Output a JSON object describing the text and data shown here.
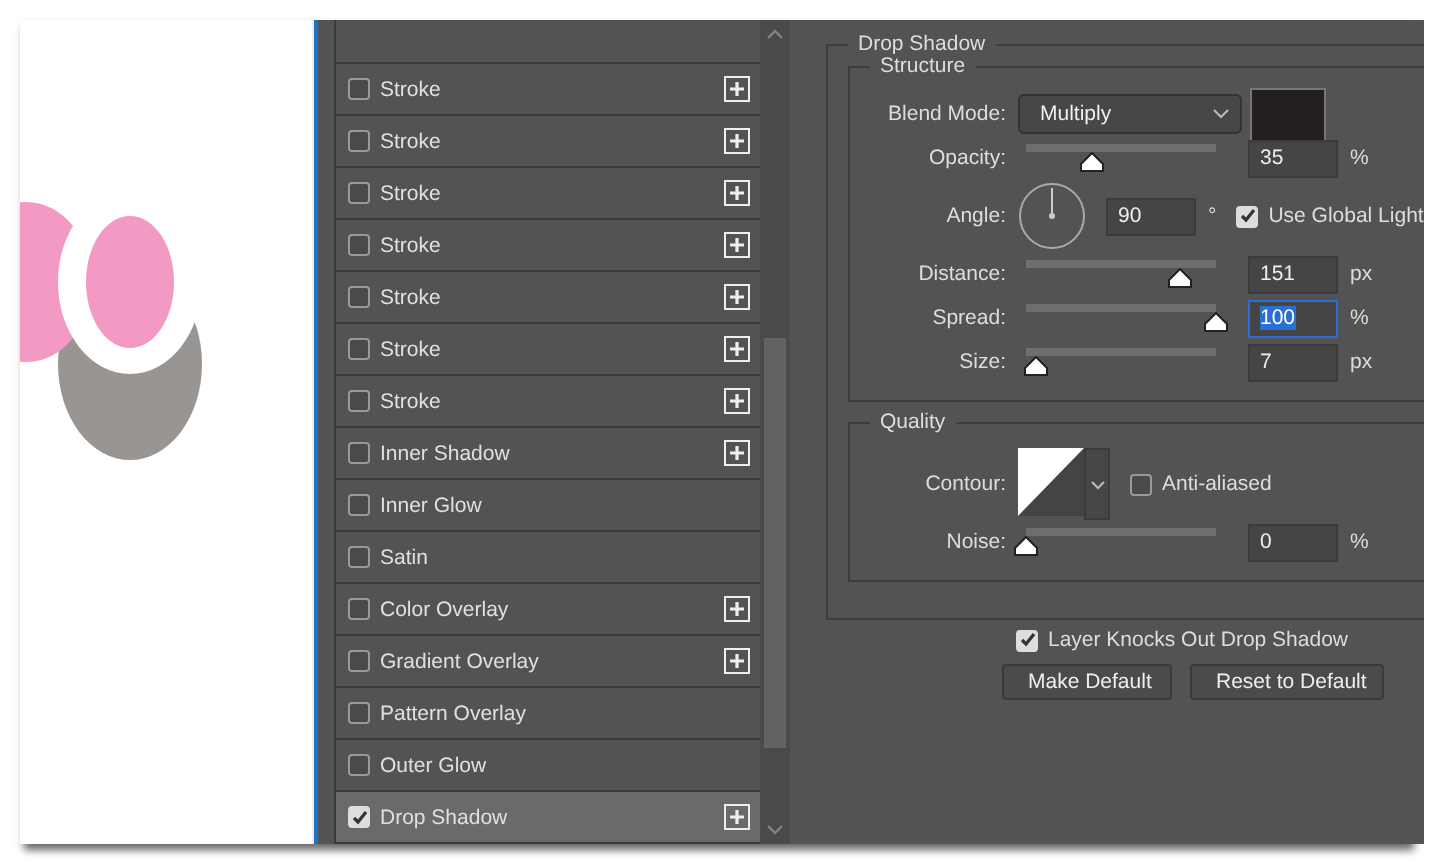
{
  "styles_list": [
    {
      "label": "Stroke",
      "checked": false,
      "addable": true,
      "selected": false
    },
    {
      "label": "Stroke",
      "checked": false,
      "addable": true,
      "selected": false
    },
    {
      "label": "Stroke",
      "checked": false,
      "addable": true,
      "selected": false
    },
    {
      "label": "Stroke",
      "checked": false,
      "addable": true,
      "selected": false
    },
    {
      "label": "Stroke",
      "checked": false,
      "addable": true,
      "selected": false
    },
    {
      "label": "Stroke",
      "checked": false,
      "addable": true,
      "selected": false
    },
    {
      "label": "Stroke",
      "checked": false,
      "addable": true,
      "selected": false
    },
    {
      "label": "Inner Shadow",
      "checked": false,
      "addable": true,
      "selected": false
    },
    {
      "label": "Inner Glow",
      "checked": false,
      "addable": false,
      "selected": false
    },
    {
      "label": "Satin",
      "checked": false,
      "addable": false,
      "selected": false
    },
    {
      "label": "Color Overlay",
      "checked": false,
      "addable": true,
      "selected": false
    },
    {
      "label": "Gradient Overlay",
      "checked": false,
      "addable": true,
      "selected": false
    },
    {
      "label": "Pattern Overlay",
      "checked": false,
      "addable": false,
      "selected": false
    },
    {
      "label": "Outer Glow",
      "checked": false,
      "addable": false,
      "selected": false
    },
    {
      "label": "Drop Shadow",
      "checked": true,
      "addable": true,
      "selected": true
    }
  ],
  "drop_shadow": {
    "title": "Drop Shadow",
    "structure": {
      "title": "Structure",
      "blend_mode": {
        "label": "Blend Mode:",
        "value": "Multiply"
      },
      "rows": [
        {
          "kind": "slider",
          "label": "Opacity:",
          "level": 0.35,
          "value": "35",
          "unit": "%",
          "highlighted": false
        },
        {
          "kind": "angle",
          "label": "Angle:",
          "value": "90",
          "unit": "°",
          "global_light": {
            "label": "Use Global Light",
            "checked": true
          }
        },
        {
          "kind": "slider",
          "label": "Distance:",
          "level": 0.81,
          "value": "151",
          "unit": "px",
          "highlighted": false
        },
        {
          "kind": "slider",
          "label": "Spread:",
          "level": 1,
          "value": "100",
          "unit": "%",
          "highlighted": true
        },
        {
          "kind": "slider",
          "label": "Size:",
          "level": 0.05,
          "value": "7",
          "unit": "px",
          "highlighted": false
        }
      ]
    },
    "quality": {
      "title": "Quality",
      "contour": {
        "label": "Contour:",
        "anti_aliased": {
          "label": "Anti-aliased",
          "checked": false
        }
      },
      "noise": {
        "label": "Noise:",
        "level": 0,
        "value": "0",
        "unit": "%"
      }
    },
    "knockout": {
      "label": "Layer Knocks Out Drop Shadow",
      "checked": true
    },
    "buttons": [
      "Make Default",
      "Reset to Default"
    ]
  }
}
